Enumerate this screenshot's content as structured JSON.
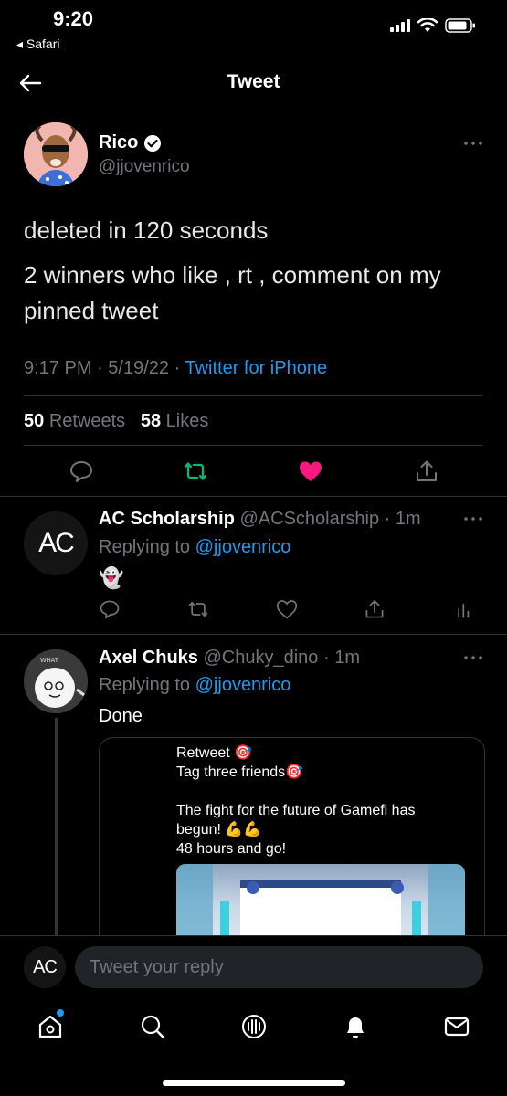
{
  "status_bar": {
    "time": "9:20",
    "back_app": "◂ Safari"
  },
  "nav": {
    "title": "Tweet"
  },
  "tweet": {
    "author_name": "Rico",
    "author_handle": "@jjovenrico",
    "text_line1": "deleted in 120 seconds",
    "text_line2": "2 winners who like , rt , comment on my",
    "text_line3": "pinned tweet",
    "time": "9:17 PM",
    "date": "5/19/22",
    "sep": "·",
    "source": "Twitter for iPhone",
    "retweets_count": "50",
    "retweets_label": "Retweets",
    "likes_count": "58",
    "likes_label": "Likes"
  },
  "replies": [
    {
      "name": "AC Scholarship",
      "handle": "@ACScholarship",
      "time": "· 1m",
      "replying_prefix": "Replying to",
      "replying_to": "@jjovenrico",
      "body": "👻",
      "avatar_text": "AC"
    },
    {
      "name": "Axel Chuks",
      "handle": "@Chuky_dino",
      "time": "· 1m",
      "replying_prefix": "Replying to",
      "replying_to": "@jjovenrico",
      "body": "Done",
      "avatar_text": "WHAT",
      "quoted_line1": "Retweet 🎯",
      "quoted_line2": "Tag three friends🎯",
      "quoted_line3": "The fight for the future of Gamefi has",
      "quoted_line4": "begun! 💪💪",
      "quoted_line5": "48 hours and go!"
    }
  ],
  "reply_box": {
    "avatar_text": "AC",
    "placeholder": "Tweet your reply"
  },
  "colors": {
    "accent": "#1d9bf0",
    "retweet": "#00ba7c",
    "like": "#f91880",
    "background": "#000000"
  },
  "icons": [
    "back-arrow-icon",
    "verified-icon",
    "reply-icon",
    "retweet-icon",
    "like-icon",
    "share-icon",
    "analytics-icon",
    "home-icon",
    "search-icon",
    "spaces-icon",
    "notifications-icon",
    "messages-icon"
  ]
}
